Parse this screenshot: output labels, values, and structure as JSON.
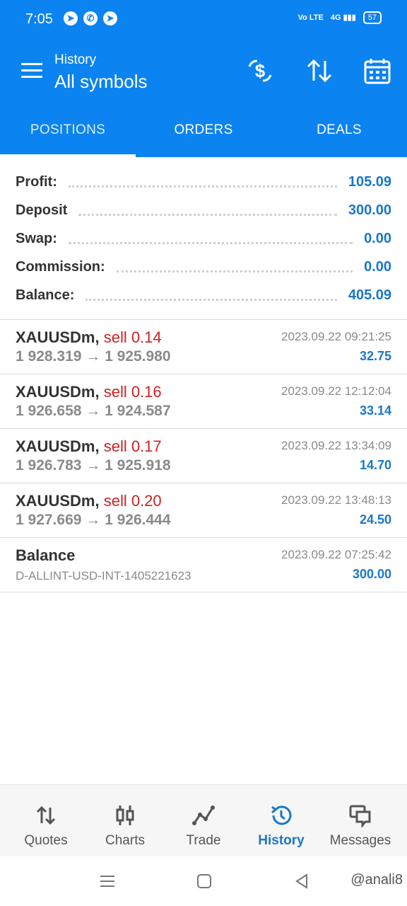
{
  "status_bar": {
    "time": "7:05",
    "network": "4G",
    "volte": "Vo LTE",
    "battery": "57"
  },
  "header": {
    "subtitle": "History",
    "title": "All symbols"
  },
  "tabs": [
    {
      "label": "POSITIONS",
      "active": true
    },
    {
      "label": "ORDERS",
      "active": false
    },
    {
      "label": "DEALS",
      "active": false
    }
  ],
  "summary": {
    "profit_label": "Profit:",
    "profit": "105.09",
    "deposit_label": "Deposit",
    "deposit": "300.00",
    "swap_label": "Swap:",
    "swap": "0.00",
    "commission_label": "Commission:",
    "commission": "0.00",
    "balance_label": "Balance:",
    "balance": "405.09"
  },
  "deals": [
    {
      "symbol": "XAUUSDm,",
      "side": "sell 0.14",
      "prices": "1 928.319 → 1 925.980",
      "time": "2023.09.22 09:21:25",
      "profit": "32.75"
    },
    {
      "symbol": "XAUUSDm,",
      "side": "sell 0.16",
      "prices": "1 926.658 → 1 924.587",
      "time": "2023.09.22 12:12:04",
      "profit": "33.14"
    },
    {
      "symbol": "XAUUSDm,",
      "side": "sell 0.17",
      "prices": "1 926.783 → 1 925.918",
      "time": "2023.09.22 13:34:09",
      "profit": "14.70"
    },
    {
      "symbol": "XAUUSDm,",
      "side": "sell 0.20",
      "prices": "1 927.669 → 1 926.444",
      "time": "2023.09.22 13:48:13",
      "profit": "24.50"
    }
  ],
  "balance_entry": {
    "title": "Balance",
    "account": "D-ALLINT-USD-INT-1405221623",
    "time": "2023.09.22 07:25:42",
    "amount": "300.00"
  },
  "bottom_nav": [
    {
      "label": "Quotes",
      "icon": "quotes-arrows-icon",
      "active": false
    },
    {
      "label": "Charts",
      "icon": "candlestick-icon",
      "active": false
    },
    {
      "label": "Trade",
      "icon": "trade-line-icon",
      "active": false
    },
    {
      "label": "History",
      "icon": "history-clock-icon",
      "active": true
    },
    {
      "label": "Messages",
      "icon": "messages-icon",
      "active": false
    }
  ],
  "watermark": "@anali8",
  "colors": {
    "primary": "#0b83f0",
    "value_blue": "#1a77c9",
    "sell_red": "#cc2222",
    "muted_gray": "#8a8a8a"
  }
}
